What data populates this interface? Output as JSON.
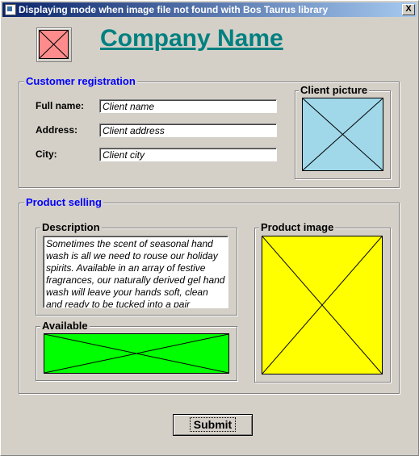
{
  "window": {
    "title": "Displaying mode when image file not found with Bos Taurus library",
    "close_label": "X"
  },
  "header": {
    "company_name": "Company Name",
    "logo_color": "#ff8c8c"
  },
  "customer": {
    "group_title": "Customer registration",
    "full_name_label": "Full name:",
    "full_name_value": "Client name",
    "address_label": "Address:",
    "address_value": "Client address",
    "city_label": "City:",
    "city_value": "Client city",
    "picture_title": "Client picture",
    "picture_color": "#a0d8ea"
  },
  "product": {
    "group_title": "Product selling",
    "description_title": "Description",
    "description_text": "Sometimes the scent of seasonal hand wash is all we need to rouse our holiday spirits. Available in an array of festive fragrances, our naturally derived gel hand wash will leave your hands soft, clean and ready to be tucked into a pair",
    "available_title": "Available",
    "available_color": "#00ff00",
    "image_title": "Product image",
    "image_color": "#ffff00"
  },
  "submit_label": "Submit"
}
